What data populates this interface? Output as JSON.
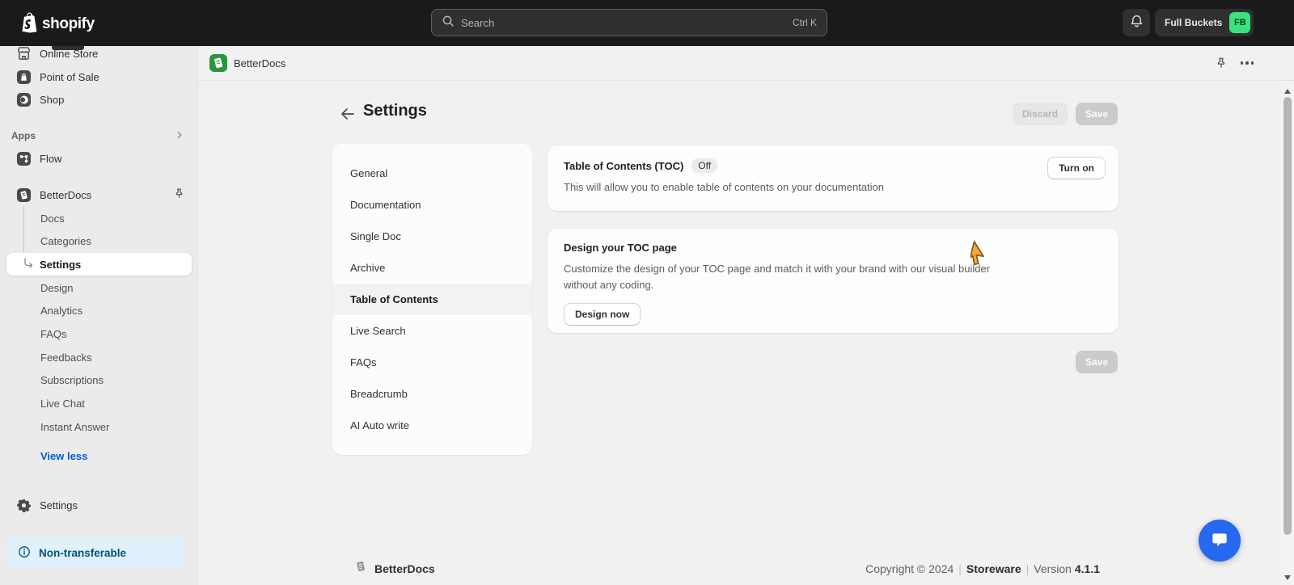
{
  "topbar": {
    "logo_text": "shopify",
    "search": {
      "placeholder": "Search",
      "shortcut": "Ctrl K"
    },
    "user": {
      "name": "Full Buckets",
      "initials": "FB"
    }
  },
  "sidebar": {
    "primary": [
      "Online Store",
      "Point of Sale",
      "Shop"
    ],
    "apps_header": "Apps",
    "flow": "Flow",
    "betterdocs": {
      "label": "BetterDocs",
      "children": [
        "Docs",
        "Categories",
        "Settings",
        "Design",
        "Analytics",
        "FAQs",
        "Feedbacks",
        "Subscriptions",
        "Live Chat",
        "Instant Answer"
      ],
      "selected": "Settings"
    },
    "view_less": "View less",
    "settings": "Settings",
    "non_transferable": "Non-transferable"
  },
  "app_header": {
    "title": "BetterDocs"
  },
  "page": {
    "title": "Settings",
    "discard": "Discard",
    "save": "Save",
    "nav": [
      "General",
      "Documentation",
      "Single Doc",
      "Archive",
      "Table of Contents",
      "Live Search",
      "FAQs",
      "Breadcrumb",
      "AI Auto write"
    ],
    "nav_selected": "Table of Contents",
    "cards": [
      {
        "title": "Table of Contents (TOC)",
        "badge": "Off",
        "description": "This will allow you to enable table of contents on your documentation",
        "action": "Turn on"
      },
      {
        "title": "Design your TOC page",
        "description": "Customize the design of your TOC page and match it with your brand with our visual builder without any coding.",
        "action": "Design now"
      }
    ],
    "save_bottom": "Save"
  },
  "footer": {
    "brand": "BetterDocs",
    "copyright": "Copyright © 2024",
    "separator": "|",
    "company": "Storeware",
    "version_label": "Version",
    "version": "4.1.1"
  },
  "colors": {
    "topbar_bg": "#1a1a1a",
    "avatar_green": "#3be27d",
    "link_blue": "#005bd3",
    "info_badge_bg": "#e0f1fc",
    "info_badge_text": "#00527c",
    "app_icon_green": "#27963c",
    "chat_blue": "#2469f0",
    "cursor_orange": "#f2a73b"
  }
}
